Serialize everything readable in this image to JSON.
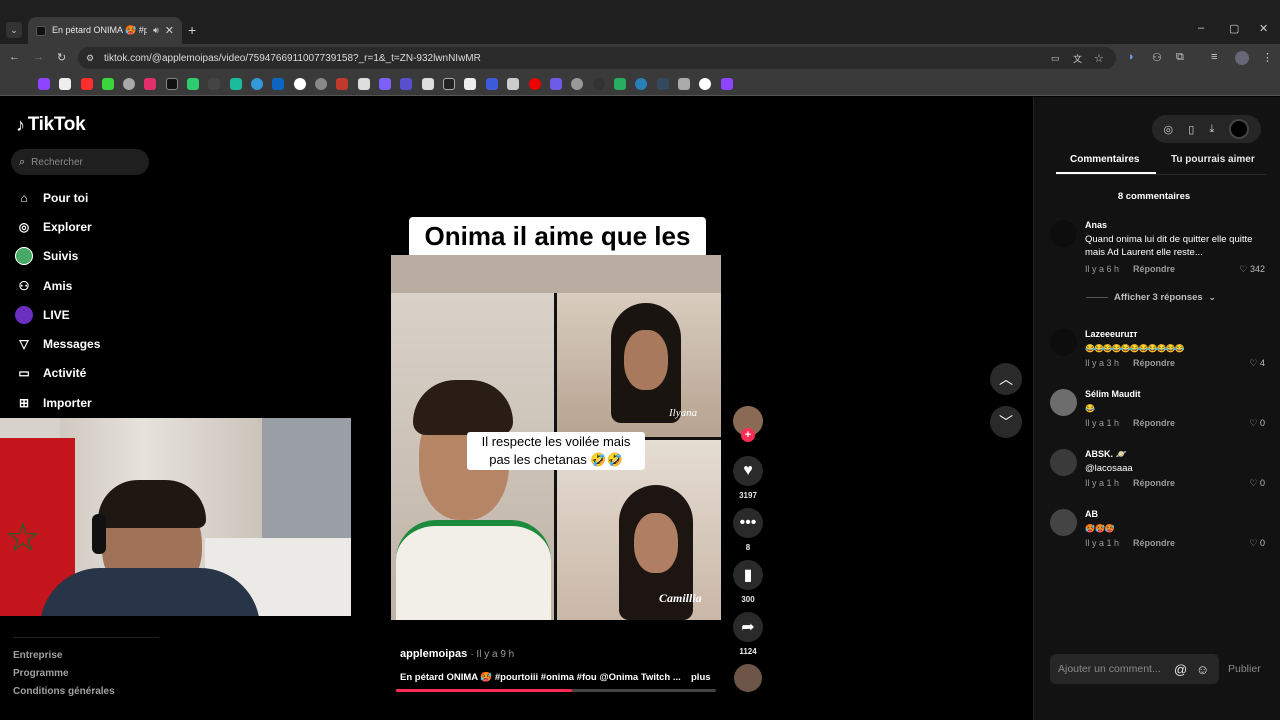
{
  "browser": {
    "tab_title": "En pétard ONIMA 🥵 #pour",
    "url": "tiktok.com/@applemoipas/video/7594766911007739158?_r=1&_t=ZN-932lwnNIwMR"
  },
  "sidebar": {
    "logo": "TikTok",
    "search_placeholder": "Rechercher",
    "nav": [
      {
        "label": "Pour toi"
      },
      {
        "label": "Explorer"
      },
      {
        "label": "Suivis"
      },
      {
        "label": "Amis"
      },
      {
        "label": "LIVE"
      },
      {
        "label": "Messages"
      },
      {
        "label": "Activité"
      },
      {
        "label": "Importer"
      }
    ],
    "footer": [
      "Entreprise",
      "Programme",
      "Conditions générales"
    ]
  },
  "video": {
    "caption_top": "Onima il aime que les chetana 🤣 🤣 🤣",
    "caption_mid": "Il respecte les voilée mais pas les chetanas 🤣🤣",
    "tag_top": "Ilyana",
    "tag_bottom": "Camillia",
    "author": "applemoipas",
    "time": "· Il y a 9 h",
    "description": "En pétard ONIMA 🥵 #pourtoiii #onima #fou @Onima Twitch ...",
    "more": "plus",
    "likes": "3197",
    "comments": "8",
    "saves": "300",
    "shares": "1124"
  },
  "panel": {
    "tab_comments": "Commentaires",
    "tab_suggest": "Tu pourrais aimer",
    "count": "8 commentaires",
    "reply_label": "Répondre",
    "show_replies": "Afficher 3 réponses",
    "comments": [
      {
        "name": "Anas",
        "text": "Quand onima lui dit de quitter elle quitte mais Ad Laurent elle reste...",
        "time": "Il y a 6 h",
        "likes": "342"
      },
      {
        "name": "Lazeeeuruɪᴛ",
        "text": "😂😂😂😂😂😂😂😂😂😂😂",
        "time": "Il y a 3 h",
        "likes": "4"
      },
      {
        "name": "Sélim Maudit",
        "text": "😂",
        "time": "Il y a 1 h",
        "likes": "0"
      },
      {
        "name": "ABSK. 🪐",
        "text": "@lacosaaa",
        "time": "Il y a 1 h",
        "likes": "0"
      },
      {
        "name": "AB",
        "text": "🥵🥵🥵",
        "time": "Il y a 1 h",
        "likes": "0"
      }
    ],
    "input_placeholder": "Ajouter un comment...",
    "publish": "Publier"
  }
}
